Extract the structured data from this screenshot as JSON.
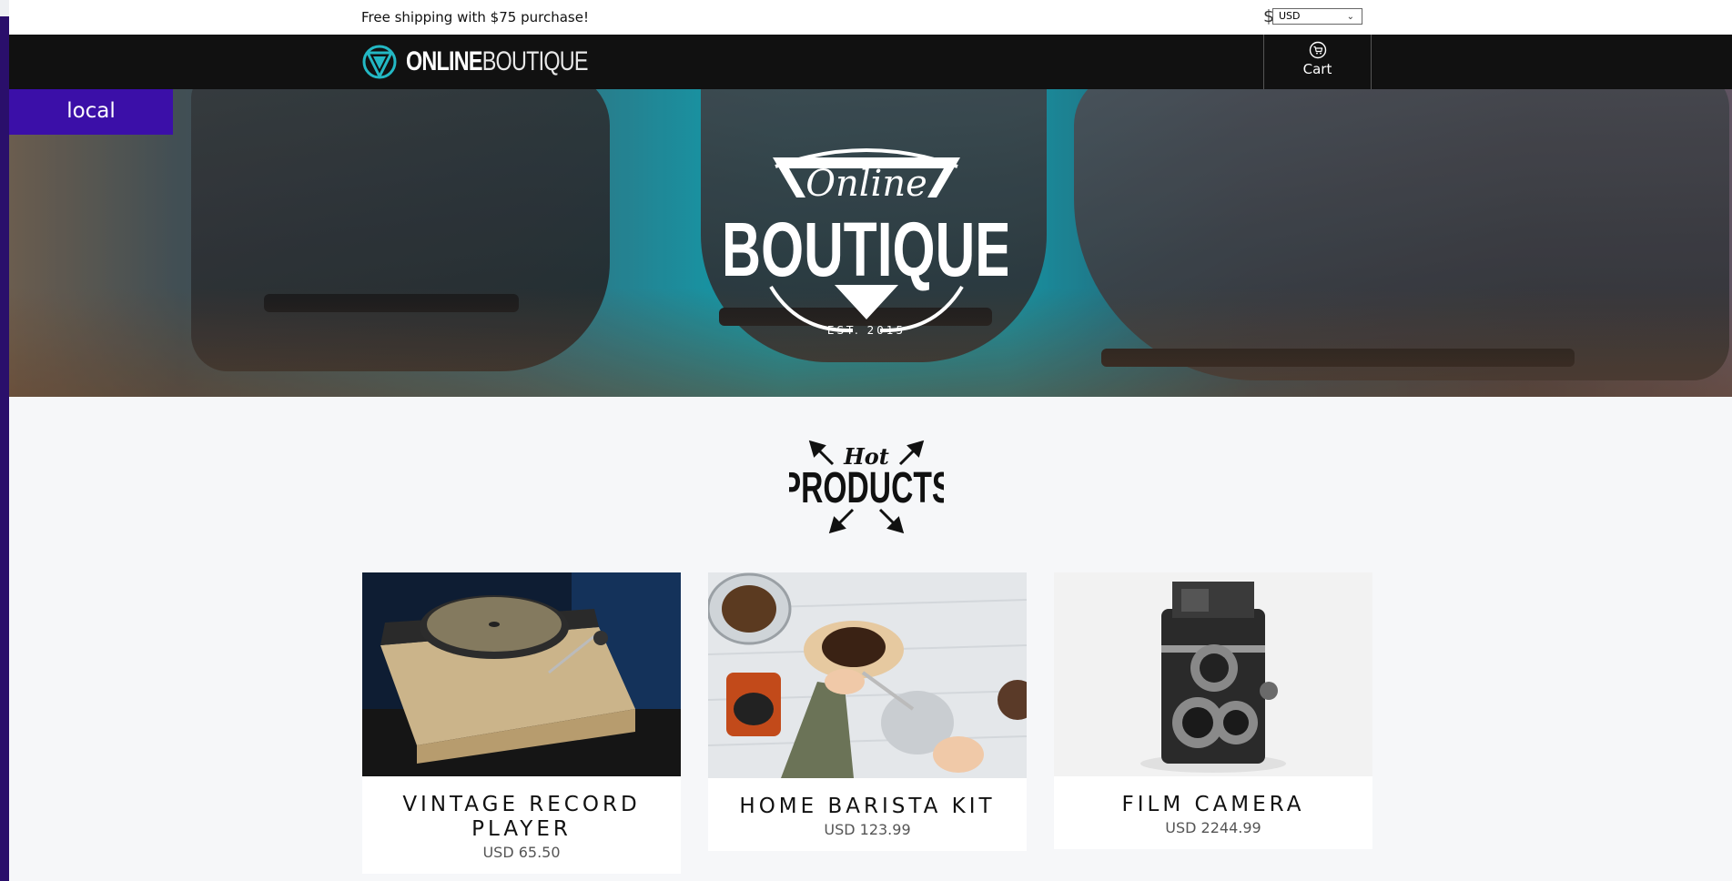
{
  "topbar": {
    "shipping_note": "Free shipping with $75 purchase!",
    "currency_symbol": "$",
    "currency_selected": "USD"
  },
  "header": {
    "logo_bold": "ONLINE",
    "logo_light": "BOUTIQUE",
    "cart_label": "Cart",
    "cart_icon": "cart-icon",
    "logo_icon": "triangle-logo-icon"
  },
  "environment_badge": "local",
  "hero": {
    "emblem_script": "Online",
    "emblem_title": "BOUTIQUE",
    "emblem_est": "EST. 2015"
  },
  "section": {
    "script": "Hot",
    "title": "PRODUCTS"
  },
  "products": [
    {
      "name": "Vintage Record Player",
      "price": "USD 65.50"
    },
    {
      "name": "Home Barista Kit",
      "price": "USD 123.99"
    },
    {
      "name": "Film Camera",
      "price": "USD 2244.99"
    }
  ],
  "colors": {
    "header_bg": "#111111",
    "accent_teal": "#23b8c4",
    "badge_bg": "#3b0fa8",
    "page_bg": "#f6f7f9"
  }
}
